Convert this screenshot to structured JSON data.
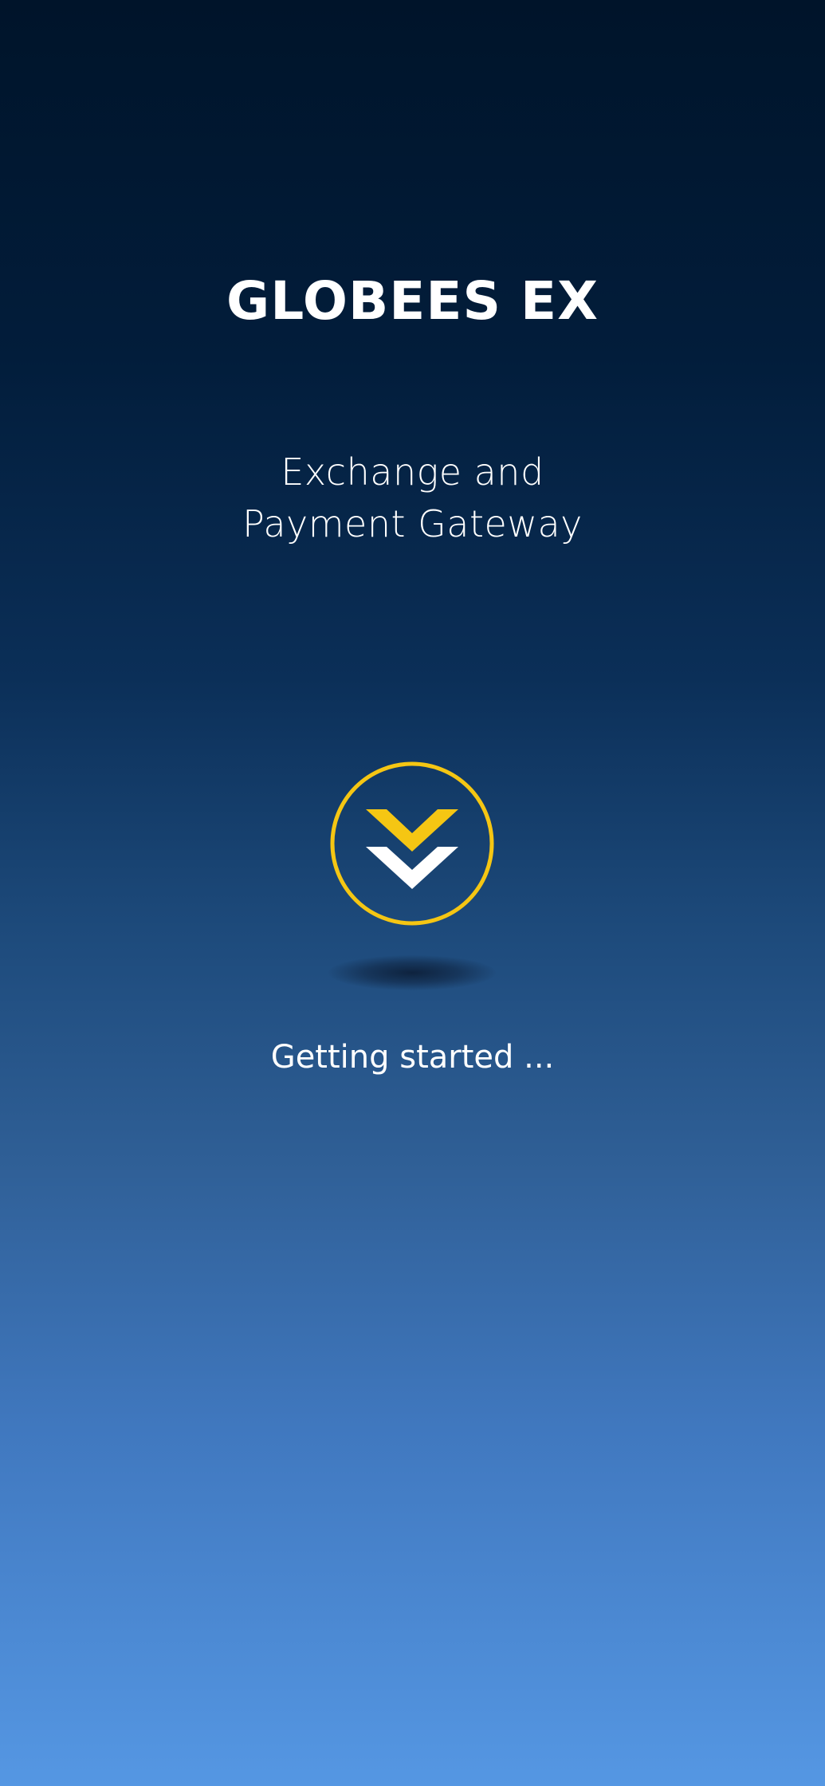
{
  "app": {
    "title": "GLOBEES EX",
    "tagline_line1": "Exchange and",
    "tagline_line2": "Payment Gateway"
  },
  "logo": {
    "icon": "double-chevron-down-icon",
    "ring_color": "#f5c613",
    "top_chevron_color": "#f5c613",
    "bottom_chevron_color": "#ffffff"
  },
  "status": {
    "text": "Getting started ..."
  },
  "colors": {
    "background_top": "#00142a",
    "background_bottom": "#5597e3",
    "accent": "#f5c613",
    "text": "#ffffff"
  }
}
